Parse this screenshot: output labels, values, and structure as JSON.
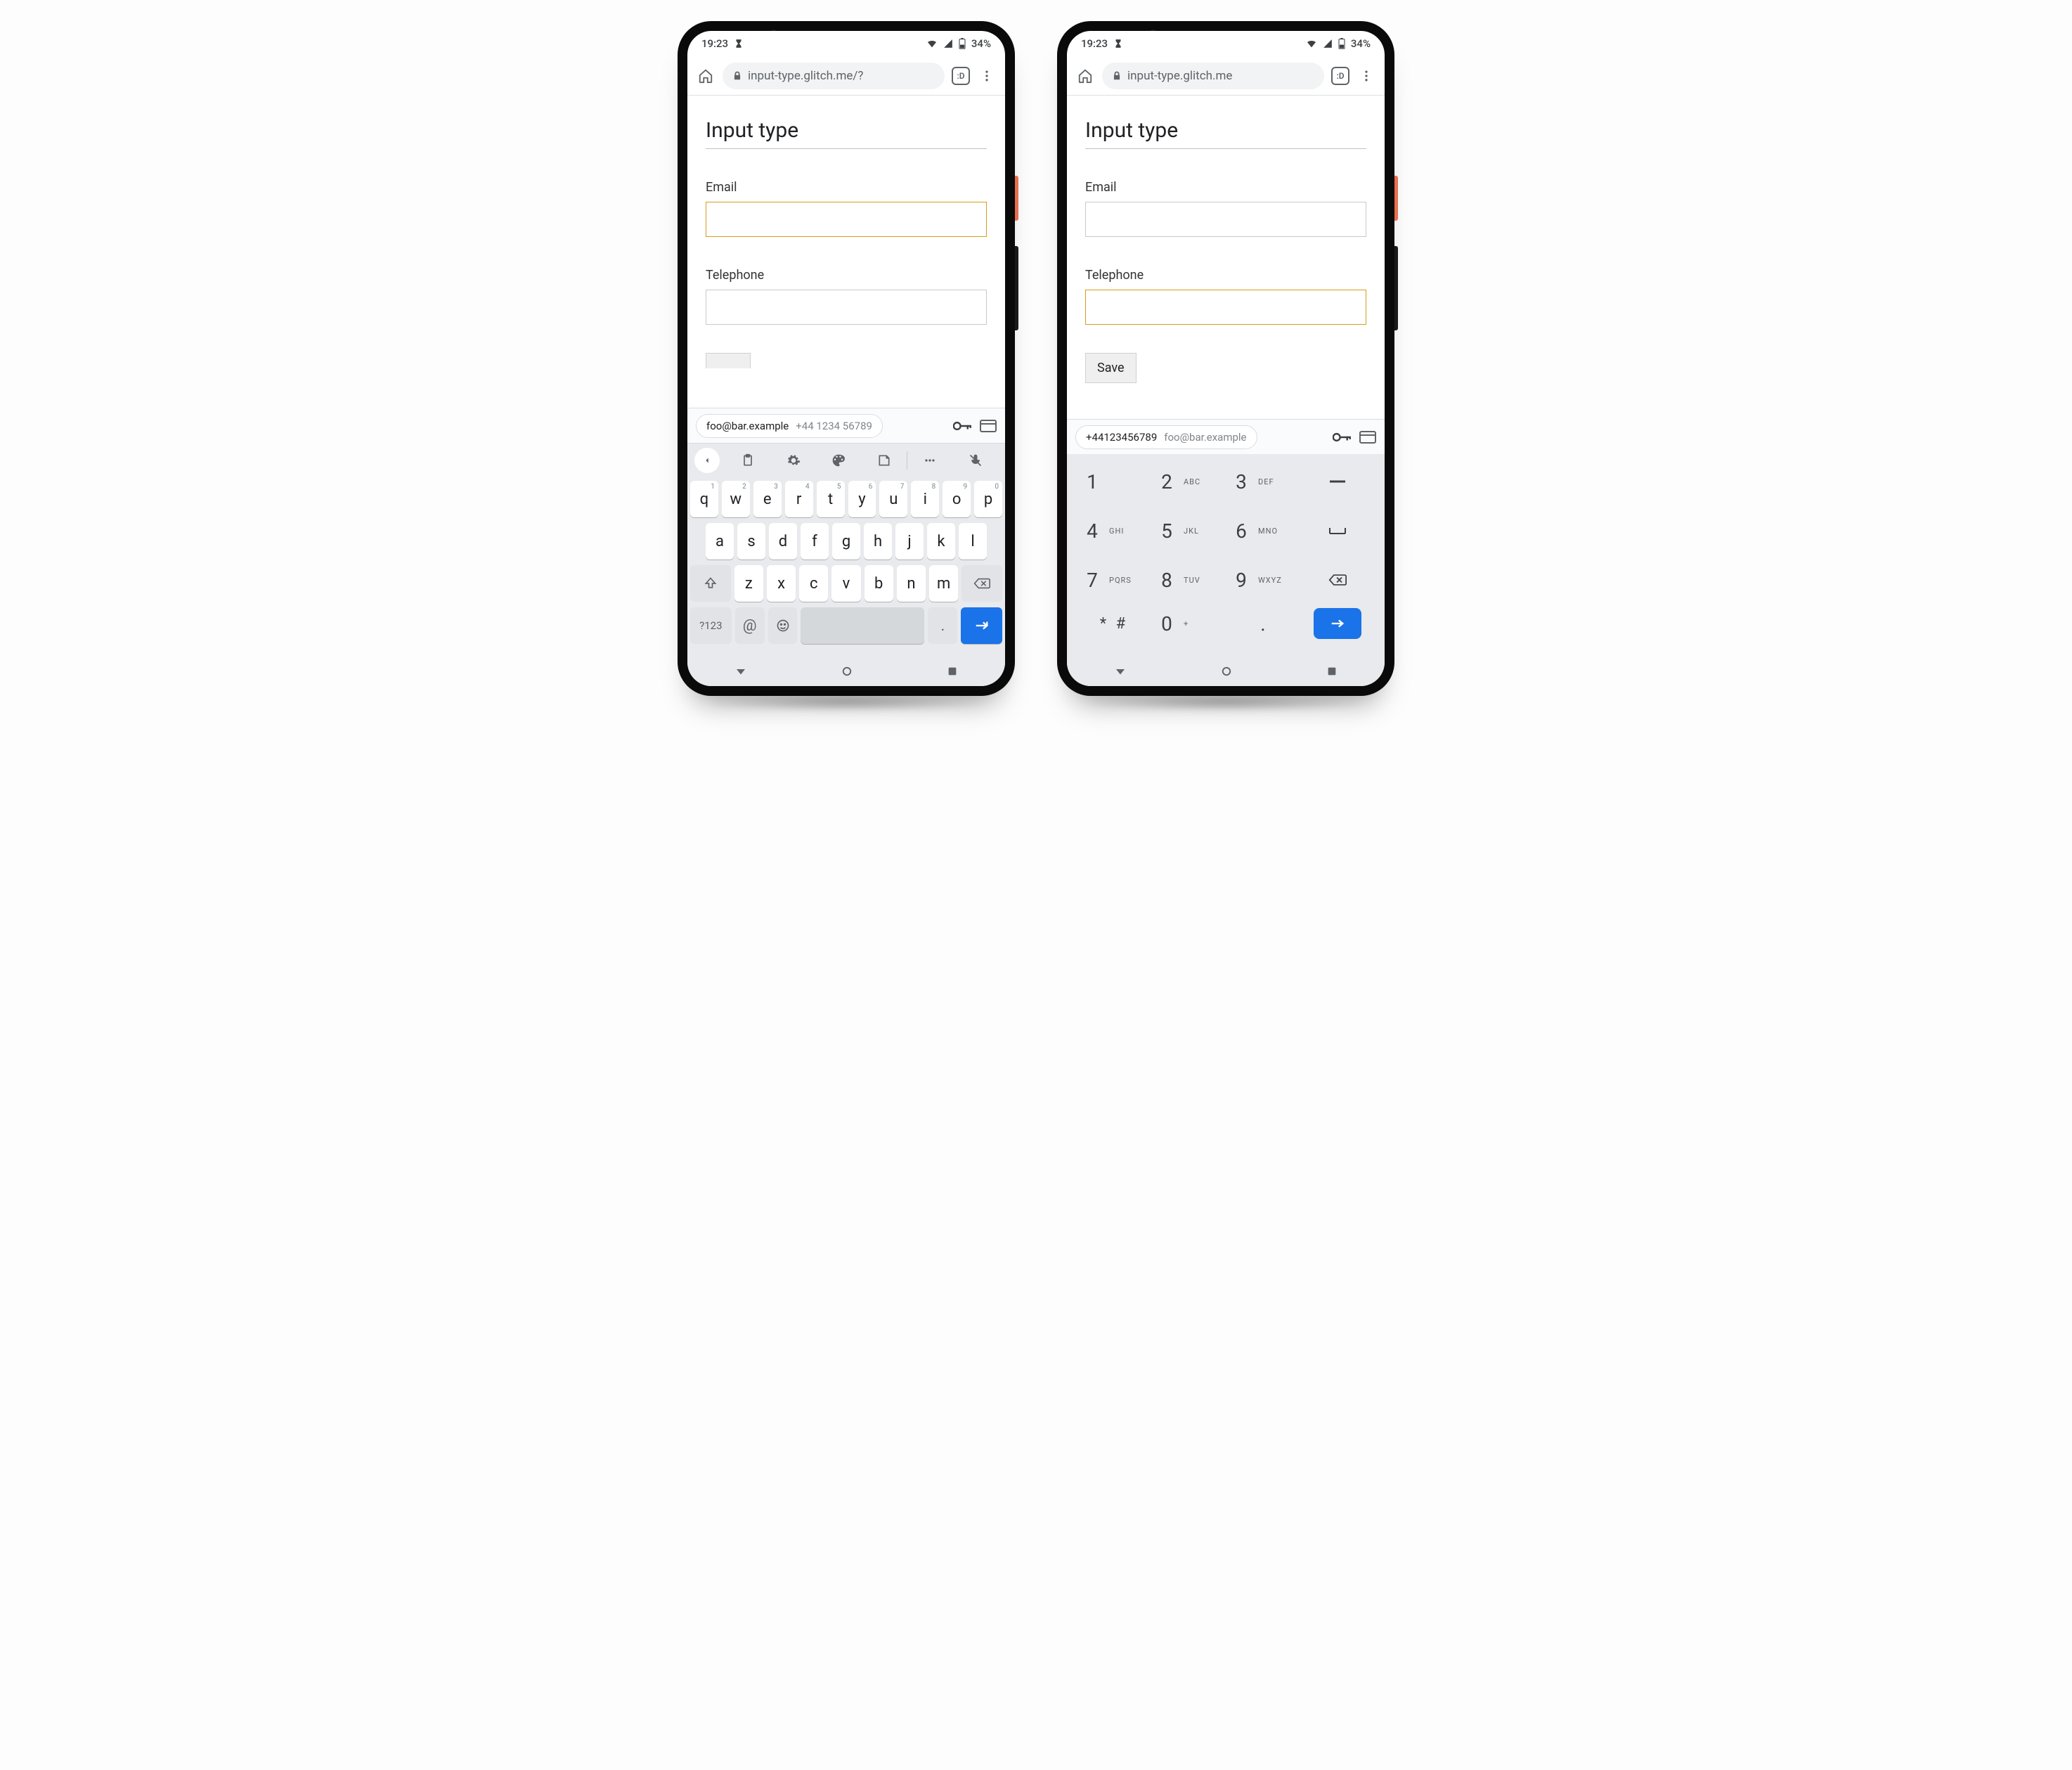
{
  "status": {
    "time": "19:23",
    "battery_text": "34%"
  },
  "browser": {
    "tab_badge": ":D"
  },
  "page": {
    "heading": "Input type",
    "email_label": "Email",
    "tel_label": "Telephone",
    "save_label": "Save"
  },
  "phone1": {
    "url": "input-type.glitch.me/?",
    "autofill_primary": "foo@bar.example",
    "autofill_secondary": "+44 1234 56789"
  },
  "phone2": {
    "url": "input-type.glitch.me",
    "autofill_primary": "+44123456789",
    "autofill_secondary": "foo@bar.example"
  },
  "qwerty": {
    "row1": [
      {
        "k": "q",
        "s": "1"
      },
      {
        "k": "w",
        "s": "2"
      },
      {
        "k": "e",
        "s": "3"
      },
      {
        "k": "r",
        "s": "4"
      },
      {
        "k": "t",
        "s": "5"
      },
      {
        "k": "y",
        "s": "6"
      },
      {
        "k": "u",
        "s": "7"
      },
      {
        "k": "i",
        "s": "8"
      },
      {
        "k": "o",
        "s": "9"
      },
      {
        "k": "p",
        "s": "0"
      }
    ],
    "row2": [
      "a",
      "s",
      "d",
      "f",
      "g",
      "h",
      "j",
      "k",
      "l"
    ],
    "row3": [
      "z",
      "x",
      "c",
      "v",
      "b",
      "n",
      "m"
    ],
    "sym_key": "?123",
    "at_key": "@",
    "dot_key": "."
  },
  "numpad": {
    "rows": [
      [
        {
          "n": "1",
          "l": ""
        },
        {
          "n": "2",
          "l": "ABC"
        },
        {
          "n": "3",
          "l": "DEF"
        }
      ],
      [
        {
          "n": "4",
          "l": "GHI"
        },
        {
          "n": "5",
          "l": "JKL"
        },
        {
          "n": "6",
          "l": "MNO"
        }
      ],
      [
        {
          "n": "7",
          "l": "PQRS"
        },
        {
          "n": "8",
          "l": "TUV"
        },
        {
          "n": "9",
          "l": "WXYZ"
        }
      ]
    ],
    "row4_left": "* #",
    "row4_mid_n": "0",
    "row4_mid_l": "+",
    "row4_dot": "."
  }
}
